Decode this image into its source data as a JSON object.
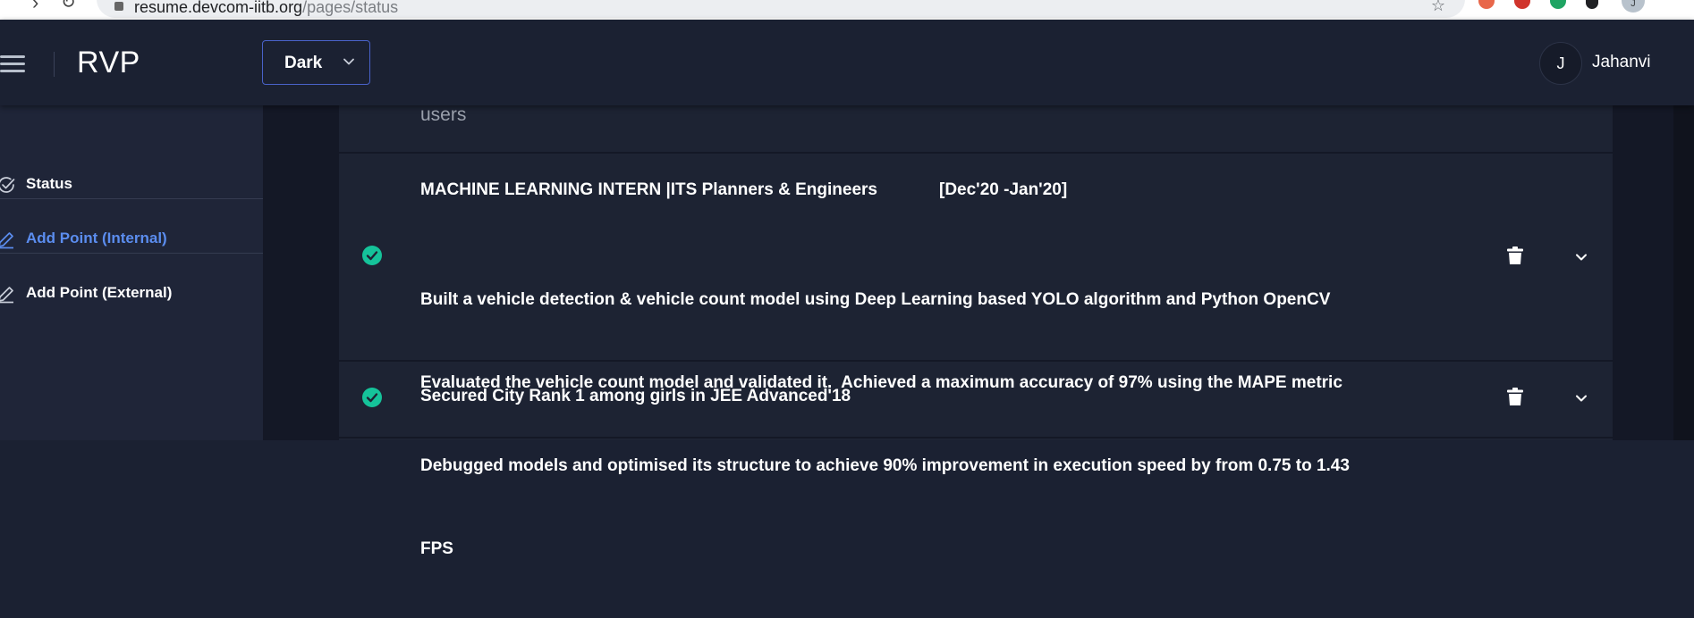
{
  "browser": {
    "url_host": "resume.devcom-iitb.org",
    "url_path": "/pages/status",
    "profile_initial": "J"
  },
  "header": {
    "title": "RVP",
    "theme_select": {
      "selected": "Dark"
    },
    "user": {
      "initial": "J",
      "name": "Jahanvi"
    }
  },
  "sidebar": {
    "items": [
      {
        "label": "Status",
        "icon": "check-circle-icon",
        "active": false
      },
      {
        "label": "Add Point (Internal)",
        "icon": "pencil-icon",
        "active": true
      },
      {
        "label": "Add Point (External)",
        "icon": "pencil-icon",
        "active": false
      }
    ]
  },
  "main": {
    "previous_entry_tail": "users",
    "entries": [
      {
        "title": "MACHINE LEARNING INTERN |ITS Planners & Engineers",
        "date": "[Dec'20 -Jan'20]",
        "lines": [
          "Built a vehicle detection & vehicle count model using Deep Learning based YOLO algorithm and Python OpenCV",
          "Evaluated the vehicle count model and validated it.  Achieved a maximum accuracy of 97% using the MAPE metric",
          "Debugged models and optimised its structure to achieve 90% improvement in execution speed by from 0.75 to 1.43",
          "FPS"
        ],
        "status": "approved"
      },
      {
        "title": "Secured City Rank 1 among girls in JEE Advanced'18",
        "status": "approved"
      }
    ]
  },
  "colors": {
    "background": "#1b2132",
    "accent": "#5b8def",
    "approved": "#15c39a",
    "select_border": "#4962c9"
  }
}
